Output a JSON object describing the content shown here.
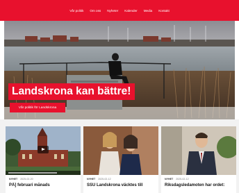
{
  "nav": {
    "items": [
      {
        "label": "Vår politik"
      },
      {
        "label": "Om oss"
      },
      {
        "label": "Nyheter"
      },
      {
        "label": "Kalender"
      },
      {
        "label": "Media"
      },
      {
        "label": "Kontakt"
      }
    ]
  },
  "hero": {
    "title": "Landskrona kan bättre!",
    "button_label": "Vår politik för Landskrona"
  },
  "cards": [
    {
      "category": "NYHET",
      "date": "2025-02-20",
      "title": "PÅ] februari månads",
      "thumb": "church-video-thumbnail"
    },
    {
      "category": "NYHET",
      "date": "2025-02-12",
      "title": "SSU Landskrona väcktes till",
      "thumb": "two-women-photo"
    },
    {
      "category": "NYHET",
      "date": "2025-02-12",
      "title": "Riksdagsledamoten har ordet:",
      "thumb": "man-in-suit-photo"
    }
  ],
  "colors": {
    "brand_red": "#e8112d",
    "card_bg": "#f2f2f2"
  }
}
